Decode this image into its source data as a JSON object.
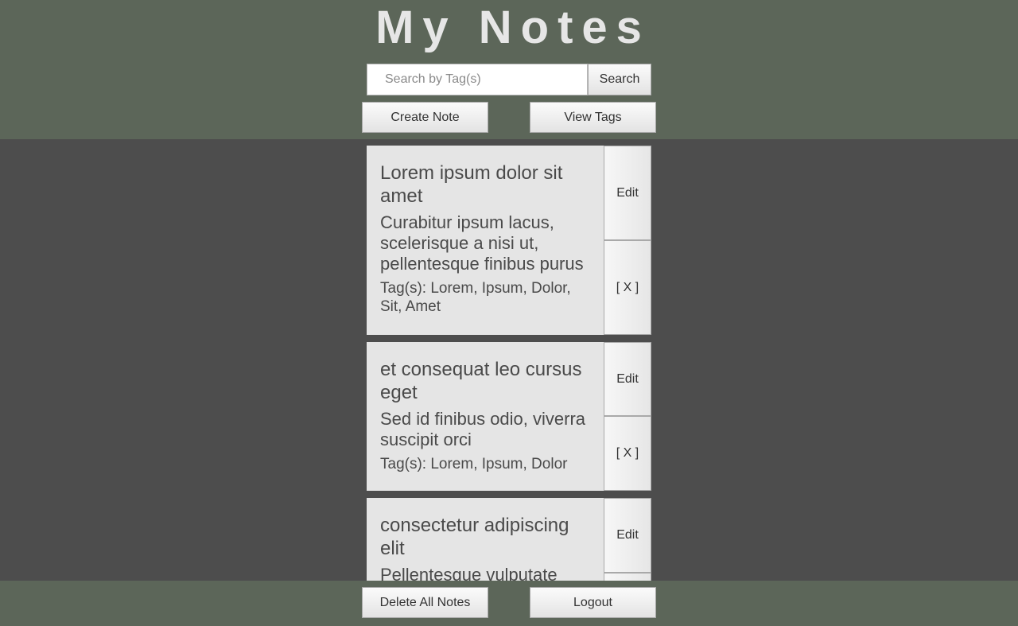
{
  "header": {
    "title": "My Notes",
    "search_placeholder": "Search by Tag(s)",
    "search_label": "Search",
    "create_label": "Create Note",
    "view_tags_label": "View Tags"
  },
  "notes": [
    {
      "title": "Lorem ipsum dolor sit amet",
      "body": "Curabitur ipsum lacus, scelerisque a nisi ut, pellentesque finibus purus",
      "tags": "Tag(s): Lorem, Ipsum, Dolor, Sit, Amet",
      "edit_label": "Edit",
      "delete_label": "[ X ]"
    },
    {
      "title": "et consequat leo cursus eget",
      "body": "Sed id finibus odio, viverra suscipit orci",
      "tags": "Tag(s): Lorem, Ipsum, Dolor",
      "edit_label": "Edit",
      "delete_label": "[ X ]"
    },
    {
      "title": "consectetur adipiscing elit",
      "body": "Pellentesque vulputate",
      "edit_label": "Edit"
    }
  ],
  "footer": {
    "delete_all_label": "Delete All Notes",
    "logout_label": "Logout"
  }
}
